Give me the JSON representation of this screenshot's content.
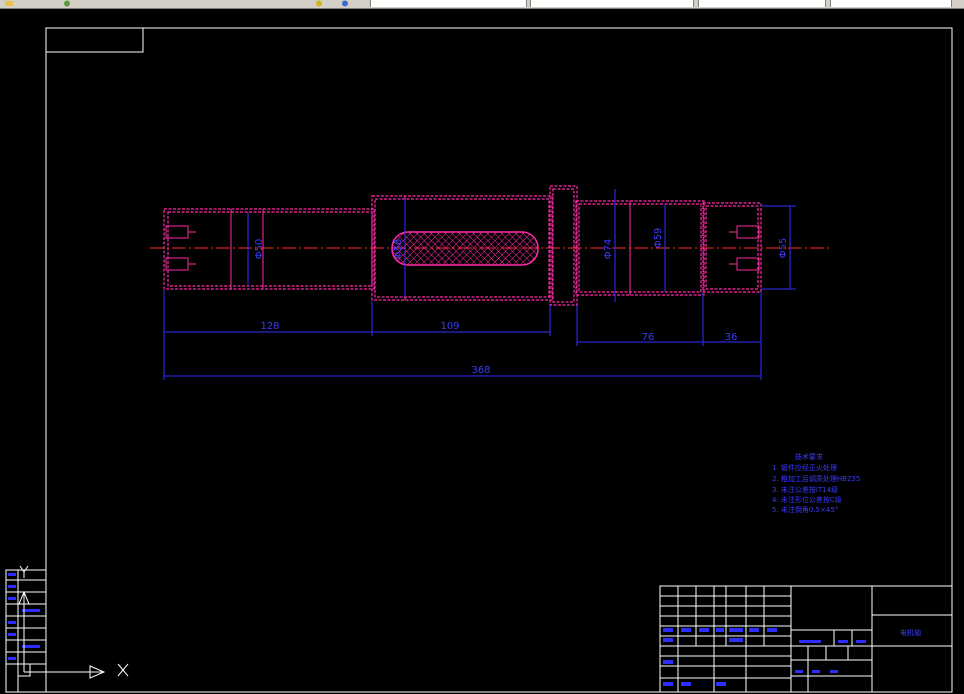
{
  "toolbar": {
    "field1": "",
    "field2": "",
    "field3": "",
    "field4": ""
  },
  "drawing": {
    "dims": {
      "d1": "128",
      "d2": "109",
      "d3": "76",
      "d4": "36",
      "total": "368",
      "dia_left": "Φ50",
      "dia_key": "Φ56",
      "dia_shoulder": "Φ74",
      "dia_right1": "Φ59",
      "dia_right2": "Φ55"
    },
    "notes": {
      "title": "技术要求",
      "items": [
        "1. 锻件应经正火处理",
        "2. 粗加工后调质处理HB235",
        "3. 未注公差按IT14级",
        "4. 未注形位公差按C级",
        "5. 未注倒角0.5×45°"
      ]
    },
    "title_block": {
      "part_name": "电机轴"
    },
    "ucs": {
      "x_label": "X",
      "y_label": "Y"
    }
  },
  "colors": {
    "outline": "#ffffff",
    "shaft": "#ff2aa8",
    "dimension": "#2f2fff",
    "centerline": "#ff2a2a"
  }
}
